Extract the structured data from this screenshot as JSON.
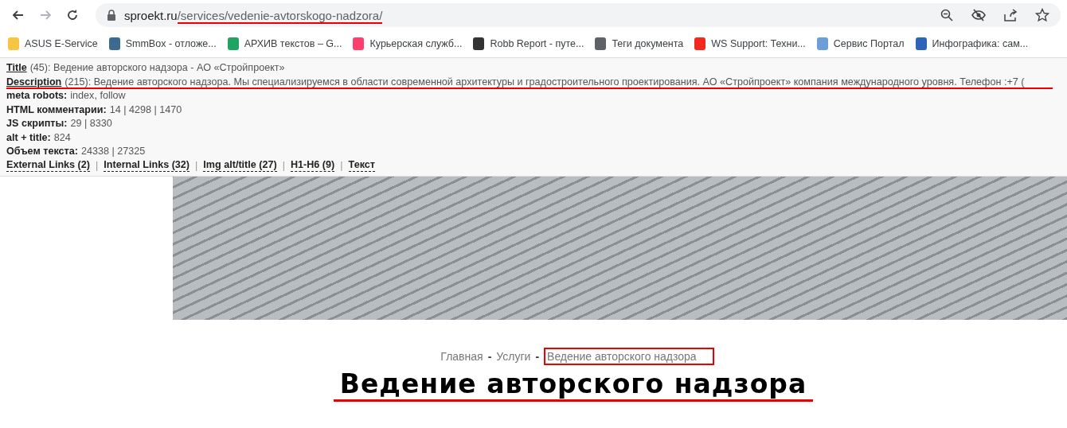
{
  "toolbar": {
    "nav_buttons": [
      {
        "kind": "back",
        "disabled": false
      },
      {
        "kind": "forward",
        "disabled": true
      },
      {
        "kind": "reload",
        "disabled": false
      }
    ],
    "address": {
      "host": "sproekt.ru",
      "path": "/services/vedenie-avtorskogo-nadzora/"
    },
    "actions": [
      {
        "kind": "zoom-out"
      },
      {
        "kind": "eye-off"
      },
      {
        "kind": "share"
      },
      {
        "kind": "star"
      }
    ]
  },
  "bookmarks": [
    {
      "label": "ASUS E-Service",
      "color": "#f6c542"
    },
    {
      "label": "SmmBox - отложе...",
      "color": "#3d6b8f"
    },
    {
      "label": "АРХИВ текстов – G...",
      "color": "#1fa463"
    },
    {
      "label": "Курьерская служб...",
      "color": "#ff3d6e"
    },
    {
      "label": "Robb Report - путе...",
      "color": "#333333"
    },
    {
      "label": "Теги документа",
      "color": "#5f6368"
    },
    {
      "label": "WS Support: Техни...",
      "color": "#f4281e"
    },
    {
      "label": "Сервис Портал",
      "color": "#6d9ed8"
    },
    {
      "label": "Инфографика: сам...",
      "color": "#2d64b7"
    }
  ],
  "seo_panel": {
    "rows": [
      {
        "kind": "link",
        "label": "Title",
        "value": "(45): Ведение авторского надзора - АО «Стройпроект»"
      },
      {
        "kind": "link",
        "label": "Description",
        "value": "(215): Ведение авторского надзора. Мы специализируемся в области современной архитектуры и градостроительного проектирования. АО «Стройпроект» компания международного уровня. Телефон :+7 ("
      },
      {
        "kind": "plain",
        "label": "meta robots:",
        "value": "index, follow"
      },
      {
        "kind": "plain",
        "label": "HTML комментарии:",
        "value": "14 | 4298 | 1470"
      },
      {
        "kind": "plain",
        "label": "JS скрипты:",
        "value": "29 | 8330"
      },
      {
        "kind": "plain",
        "label": "alt + title:",
        "value": "824"
      },
      {
        "kind": "plain",
        "label": "Объем текста:",
        "value": "24338 | 27325"
      }
    ],
    "links": [
      {
        "label": "External Links (2)",
        "separator": "|"
      },
      {
        "label": "Internal Links (32)",
        "separator": "|"
      },
      {
        "label": "Img alt/title (27)",
        "separator": "|"
      },
      {
        "label": "H1-H6 (9)",
        "separator": "|"
      },
      {
        "label": "Текст"
      }
    ]
  },
  "breadcrumbs": [
    {
      "label": "Главная",
      "separator": "-"
    },
    {
      "label": "Услуги",
      "separator": "-"
    },
    {
      "label": "Ведение авторского надзора"
    }
  ],
  "heading": "Ведение авторского надзора"
}
